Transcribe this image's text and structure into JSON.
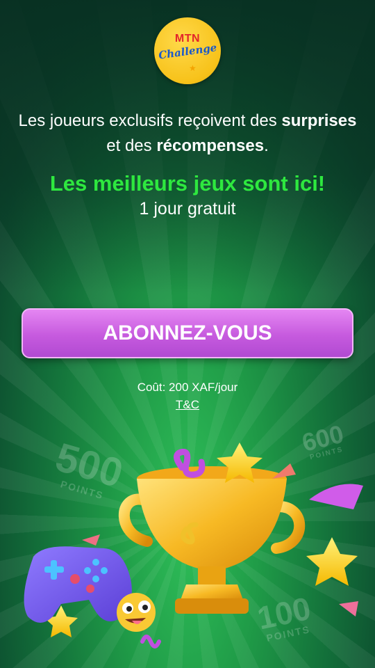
{
  "app": {
    "logo_top": "MTN",
    "logo_bottom": "Challenge"
  },
  "intro": {
    "part1": "Les joueurs exclusifs reçoivent des ",
    "bold1": "surprises",
    "part2": " et des ",
    "bold2": "récompenses",
    "part3": "."
  },
  "headline": "Les meilleurs jeux sont ici!",
  "trial": "1 jour gratuit",
  "subscribe_button": "ABONNEZ-VOUS",
  "cost": "Coût: 200 XAF/jour",
  "terms_link": "T&C",
  "decor": {
    "badge_500": "500",
    "badge_600": "600",
    "badge_100": "100",
    "badge_label": "POINTS"
  },
  "colors": {
    "background": "#1f9a47",
    "headline": "#2ee83f",
    "button": "#c65ade",
    "logo": "#f7c21a"
  },
  "icons": [
    "trophy-icon",
    "gamepad-icon",
    "star-icon",
    "emoji-face-icon",
    "confetti-icon"
  ]
}
